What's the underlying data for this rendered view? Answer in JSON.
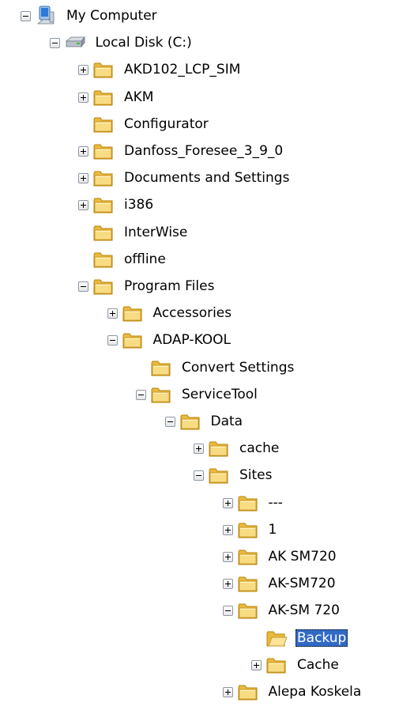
{
  "tree": [
    {
      "label": "My Computer",
      "level": 0,
      "toggle": "minus",
      "icon": "my-computer-icon"
    },
    {
      "label": "Local Disk (C:)",
      "level": 1,
      "toggle": "minus",
      "icon": "drive-icon"
    },
    {
      "label": "AKD102_LCP_SIM",
      "level": 2,
      "toggle": "plus",
      "icon": "folder-icon"
    },
    {
      "label": "AKM",
      "level": 2,
      "toggle": "plus",
      "icon": "folder-icon"
    },
    {
      "label": "Configurator",
      "level": 2,
      "toggle": "none",
      "icon": "folder-icon"
    },
    {
      "label": "Danfoss_Foresee_3_9_0",
      "level": 2,
      "toggle": "plus",
      "icon": "folder-icon"
    },
    {
      "label": "Documents and Settings",
      "level": 2,
      "toggle": "plus",
      "icon": "folder-icon"
    },
    {
      "label": "i386",
      "level": 2,
      "toggle": "plus",
      "icon": "folder-icon"
    },
    {
      "label": "InterWise",
      "level": 2,
      "toggle": "none",
      "icon": "folder-icon"
    },
    {
      "label": "offline",
      "level": 2,
      "toggle": "none",
      "icon": "folder-icon"
    },
    {
      "label": "Program Files",
      "level": 2,
      "toggle": "minus",
      "icon": "folder-icon"
    },
    {
      "label": "Accessories",
      "level": 3,
      "toggle": "plus",
      "icon": "folder-icon"
    },
    {
      "label": "ADAP-KOOL",
      "level": 3,
      "toggle": "minus",
      "icon": "folder-icon"
    },
    {
      "label": "Convert Settings",
      "level": 4,
      "toggle": "none",
      "icon": "folder-icon"
    },
    {
      "label": "ServiceTool",
      "level": 4,
      "toggle": "minus",
      "icon": "folder-icon"
    },
    {
      "label": "Data",
      "level": 5,
      "toggle": "minus",
      "icon": "folder-icon"
    },
    {
      "label": "cache",
      "level": 6,
      "toggle": "plus",
      "icon": "folder-icon"
    },
    {
      "label": "Sites",
      "level": 6,
      "toggle": "minus",
      "icon": "folder-icon"
    },
    {
      "label": "---",
      "level": 7,
      "toggle": "plus",
      "icon": "folder-icon"
    },
    {
      "label": "1",
      "level": 7,
      "toggle": "plus",
      "icon": "folder-icon"
    },
    {
      "label": "AK SM720",
      "level": 7,
      "toggle": "plus",
      "icon": "folder-icon"
    },
    {
      "label": "AK-SM720",
      "level": 7,
      "toggle": "plus",
      "icon": "folder-icon"
    },
    {
      "label": "AK-SM 720",
      "level": 7,
      "toggle": "minus",
      "icon": "folder-icon"
    },
    {
      "label": "Backup",
      "level": 8,
      "toggle": "none",
      "icon": "folder-open-icon",
      "selected": true
    },
    {
      "label": "Cache",
      "level": 8,
      "toggle": "plus",
      "icon": "folder-icon"
    },
    {
      "label": "Alepa Koskela",
      "level": 7,
      "toggle": "plus",
      "icon": "folder-icon"
    }
  ],
  "colors": {
    "selection": "#316ac5",
    "folder": "#f5d76e",
    "folder_edge": "#b8860b"
  }
}
